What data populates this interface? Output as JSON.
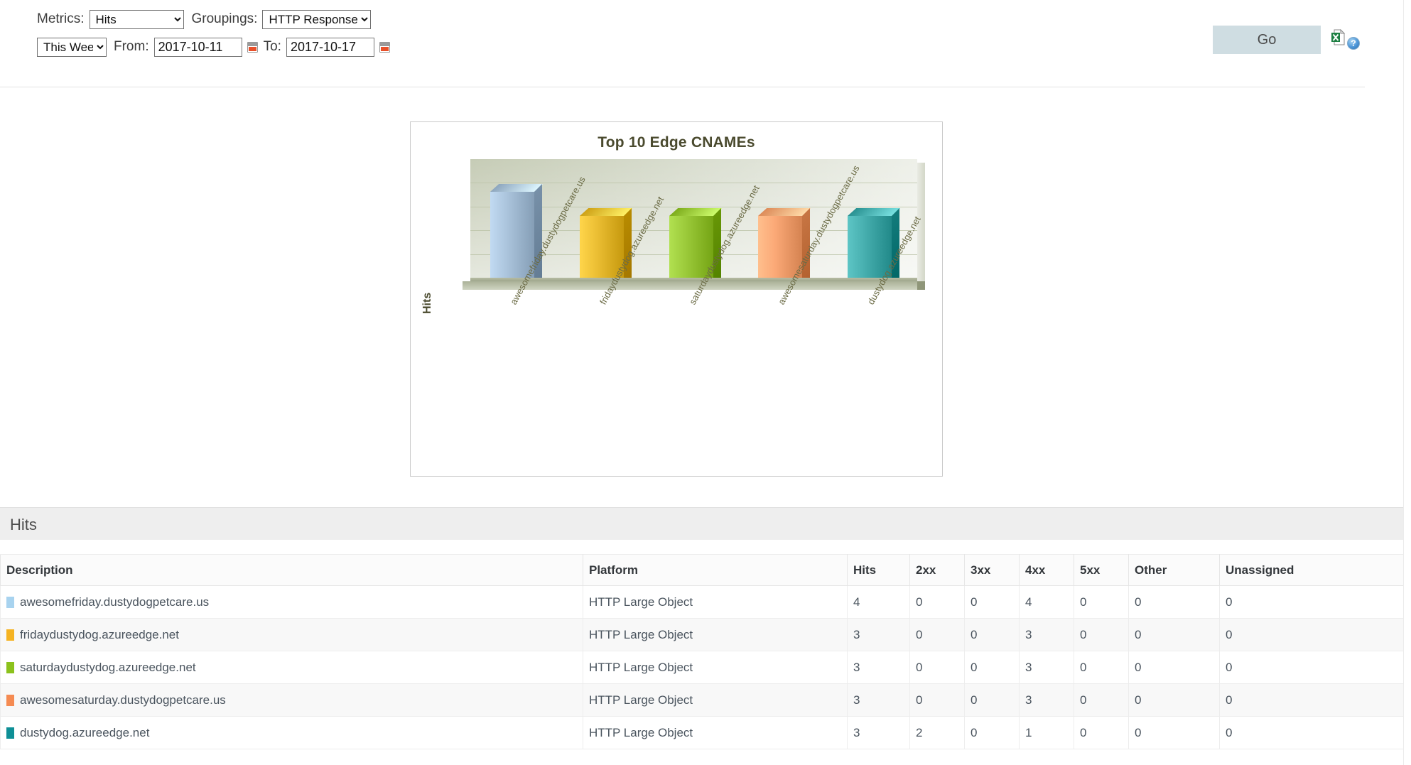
{
  "toolbar": {
    "metrics_label": "Metrics:",
    "metrics_value": "Hits",
    "groupings_label": "Groupings:",
    "groupings_value": "HTTP Response Codes",
    "range_value": "This Week",
    "from_label": "From:",
    "from_value": "2017-10-11",
    "to_label": "To:",
    "to_value": "2017-10-17",
    "go_label": "Go",
    "excel_icon": "excel-export-icon",
    "help_icon": "help-icon",
    "help_glyph": "?",
    "calendar_icon": "calendar-icon"
  },
  "chart_data": {
    "type": "bar",
    "title": "Top 10 Edge CNAMEs",
    "xlabel": "",
    "ylabel": "Hits",
    "grid": true,
    "legend": "none",
    "ylim": [
      0,
      5
    ],
    "categories": [
      "awesomefriday.dustydogpetcare.us",
      "fridaydustydog.azureedge.net",
      "saturdaydustydog.azureedge.net",
      "awesomesaturday.dustydogpetcare.us",
      "dustydog.azureedge.net"
    ],
    "values": [
      4,
      3,
      3,
      3,
      3
    ],
    "colors": [
      "#9fb8d0",
      "#e0b328",
      "#8fbe2e",
      "#ef9d6b",
      "#3ba3a3"
    ]
  },
  "section": {
    "title": "Hits"
  },
  "table": {
    "columns": [
      "Description",
      "Platform",
      "Hits",
      "2xx",
      "3xx",
      "4xx",
      "5xx",
      "Other",
      "Unassigned"
    ],
    "rows": [
      {
        "swatch": "#a8d3ef",
        "description": "awesomefriday.dustydogpetcare.us",
        "platform": "HTTP Large Object",
        "hits": "4",
        "c2xx": "0",
        "c3xx": "0",
        "c4xx": "4",
        "c5xx": "0",
        "other": "0",
        "unassigned": "0"
      },
      {
        "swatch": "#f5b322",
        "description": "fridaydustydog.azureedge.net",
        "platform": "HTTP Large Object",
        "hits": "3",
        "c2xx": "0",
        "c3xx": "0",
        "c4xx": "3",
        "c5xx": "0",
        "other": "0",
        "unassigned": "0"
      },
      {
        "swatch": "#8cc21c",
        "description": "saturdaydustydog.azureedge.net",
        "platform": "HTTP Large Object",
        "hits": "3",
        "c2xx": "0",
        "c3xx": "0",
        "c4xx": "3",
        "c5xx": "0",
        "other": "0",
        "unassigned": "0"
      },
      {
        "swatch": "#f58b52",
        "description": "awesomesaturday.dustydogpetcare.us",
        "platform": "HTTP Large Object",
        "hits": "3",
        "c2xx": "0",
        "c3xx": "0",
        "c4xx": "3",
        "c5xx": "0",
        "other": "0",
        "unassigned": "0"
      },
      {
        "swatch": "#0e8f96",
        "description": "dustydog.azureedge.net",
        "platform": "HTTP Large Object",
        "hits": "3",
        "c2xx": "2",
        "c3xx": "0",
        "c4xx": "1",
        "c5xx": "0",
        "other": "0",
        "unassigned": "0"
      }
    ]
  }
}
